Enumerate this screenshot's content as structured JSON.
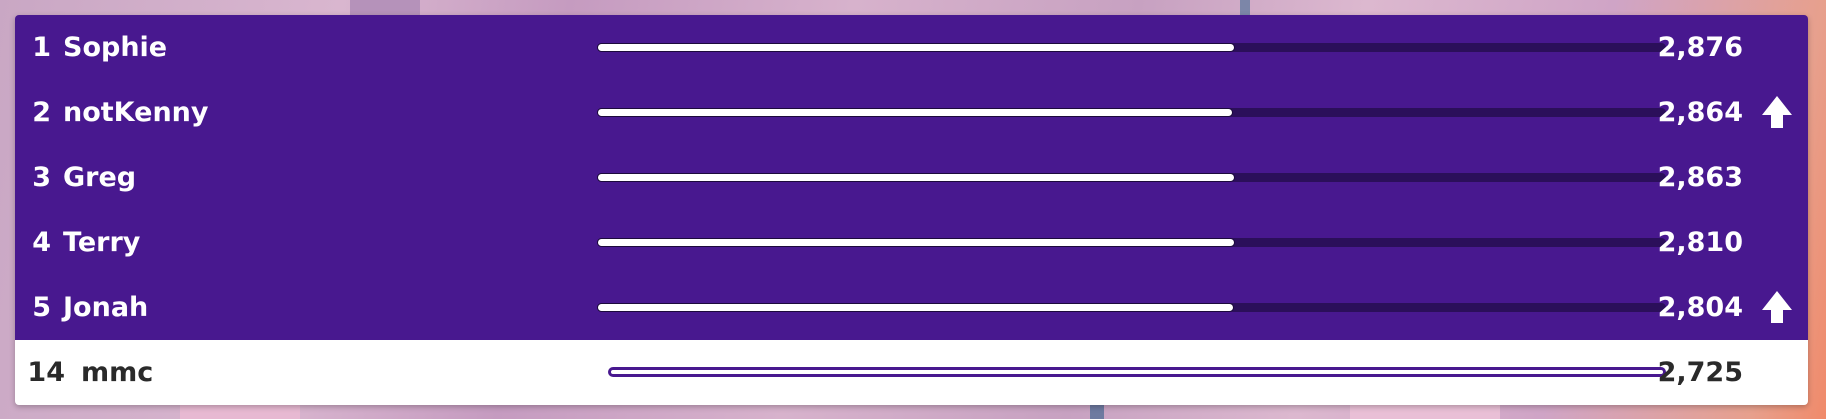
{
  "leaderboard": {
    "colors": {
      "row_bg": "#48188f",
      "self_bg": "#ffffff",
      "bar_fill": "#ffffff",
      "bar_track": "#2b0f5a"
    },
    "max_score": 2876,
    "rows": [
      {
        "rank": "1",
        "name": "Sophie",
        "score": "2,876",
        "progress": 0.597,
        "trend": ""
      },
      {
        "rank": "2",
        "name": "notKenny",
        "score": "2,864",
        "progress": 0.595,
        "trend": "up-arrow-icon"
      },
      {
        "rank": "3",
        "name": "Greg",
        "score": "2,863",
        "progress": 0.597,
        "trend": ""
      },
      {
        "rank": "4",
        "name": "Terry",
        "score": "2,810",
        "progress": 0.597,
        "trend": ""
      },
      {
        "rank": "5",
        "name": "Jonah",
        "score": "2,804",
        "progress": 0.596,
        "trend": "up-arrow-icon"
      }
    ],
    "self": {
      "rank": "14",
      "name": "mmc",
      "score": "2,725",
      "progress": 0
    }
  }
}
